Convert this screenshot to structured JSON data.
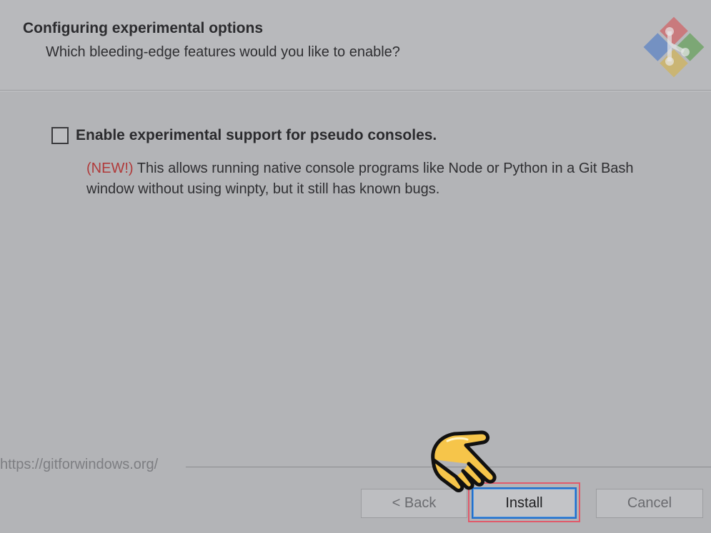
{
  "header": {
    "title": "Configuring experimental options",
    "subtitle": "Which bleeding-edge features would you like to enable?",
    "logo_icon": "git-logo-icon"
  },
  "option": {
    "label": "Enable experimental support for pseudo consoles.",
    "checked": false,
    "description_new": "(NEW!)",
    "description_text": " This allows running native console programs like Node or Python in a Git Bash window without using winpty, but it still has known bugs."
  },
  "footer": {
    "url": "https://gitforwindows.org/"
  },
  "buttons": {
    "back_label": "< Back",
    "install_label": "Install",
    "cancel_label": "Cancel"
  },
  "overlay": {
    "pointer_icon": "pointing-hand-icon"
  },
  "colors": {
    "background": "#b3b4b7",
    "new_tag": "#b03a3a",
    "focus_border": "#1f6fcc",
    "highlight_border": "#e05a6a",
    "hand_fill": "#f6c54a"
  }
}
